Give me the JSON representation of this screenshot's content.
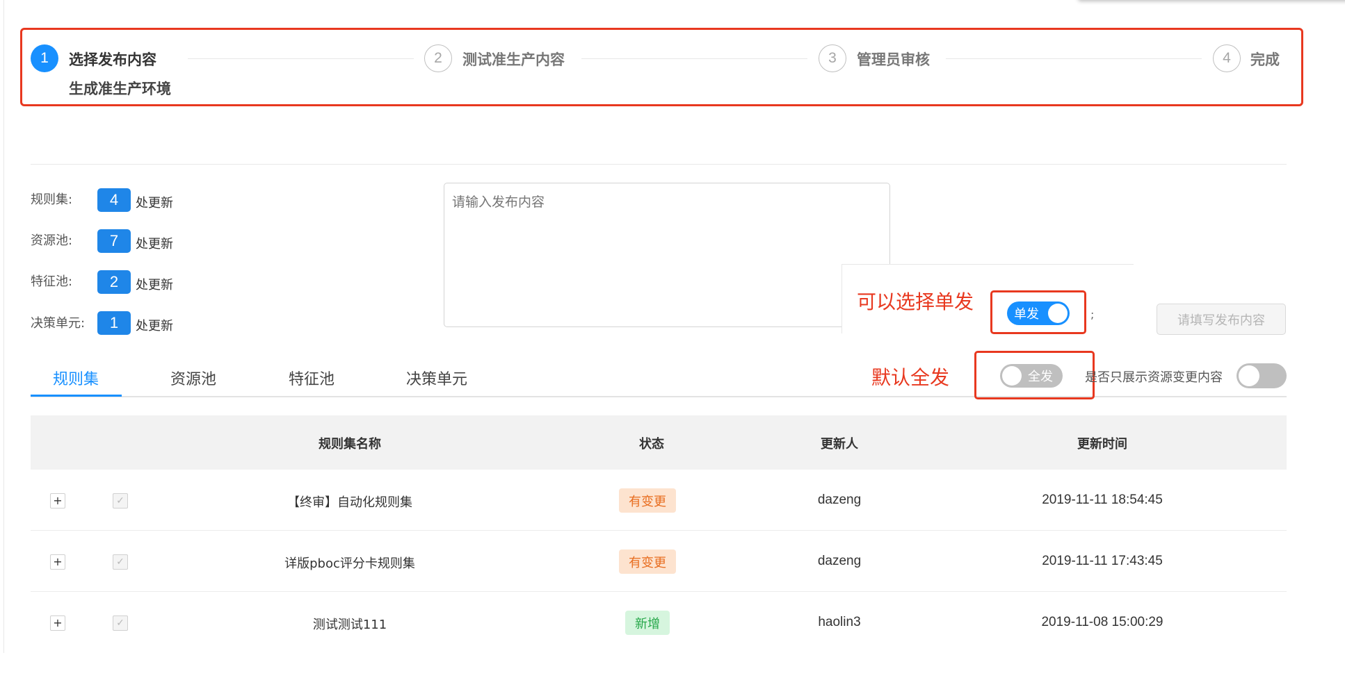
{
  "steps": [
    {
      "number": "1",
      "title": "选择发布内容",
      "description": "生成准生产环境",
      "status": "active"
    },
    {
      "number": "2",
      "title": "测试准生产内容",
      "status": "wait"
    },
    {
      "number": "3",
      "title": "管理员审核",
      "status": "wait"
    },
    {
      "number": "4",
      "title": "完成",
      "status": "wait"
    }
  ],
  "summary": {
    "update_suffix": "处更新",
    "items": [
      {
        "label": "规则集:",
        "count": "4"
      },
      {
        "label": "资源池:",
        "count": "7"
      },
      {
        "label": "特征池:",
        "count": "2"
      },
      {
        "label": "决策单元:",
        "count": "1"
      }
    ]
  },
  "publish_input": {
    "placeholder": "请输入发布内容",
    "value": ""
  },
  "annotations": {
    "single_callout": "可以选择单发",
    "all_callout": "默认全发",
    "accent_color": "#e8381f"
  },
  "single_toggle": {
    "label": "单发",
    "state": "on"
  },
  "all_toggle": {
    "label": "全发",
    "state": "off"
  },
  "semicolon": ";",
  "submit_button": {
    "label": "请填写发布内容",
    "disabled": true
  },
  "tabs": [
    {
      "label": "规则集",
      "active": true
    },
    {
      "label": "资源池",
      "active": false
    },
    {
      "label": "特征池",
      "active": false
    },
    {
      "label": "决策单元",
      "active": false
    }
  ],
  "only_changes": {
    "label": "是否只展示资源变更内容",
    "state": "off"
  },
  "table": {
    "columns": [
      "规则集名称",
      "状态",
      "更新人",
      "更新时间"
    ],
    "rows": [
      {
        "expand": "+",
        "checked": true,
        "name": "【终审】自动化规则集",
        "status": "有变更",
        "status_type": "changed",
        "updater": "dazeng",
        "time": "2019-11-11 18:54:45"
      },
      {
        "expand": "+",
        "checked": true,
        "name": "详版pboc评分卡规则集",
        "status": "有变更",
        "status_type": "changed",
        "updater": "dazeng",
        "time": "2019-11-11 17:43:45"
      },
      {
        "expand": "+",
        "checked": true,
        "name": "测试测试111",
        "status": "新增",
        "status_type": "added",
        "updater": "haolin3",
        "time": "2019-11-08 15:00:29"
      }
    ]
  },
  "colors": {
    "primary": "#1890ff",
    "changed_tag": "#e86d1f",
    "added_tag": "#27a84a"
  }
}
